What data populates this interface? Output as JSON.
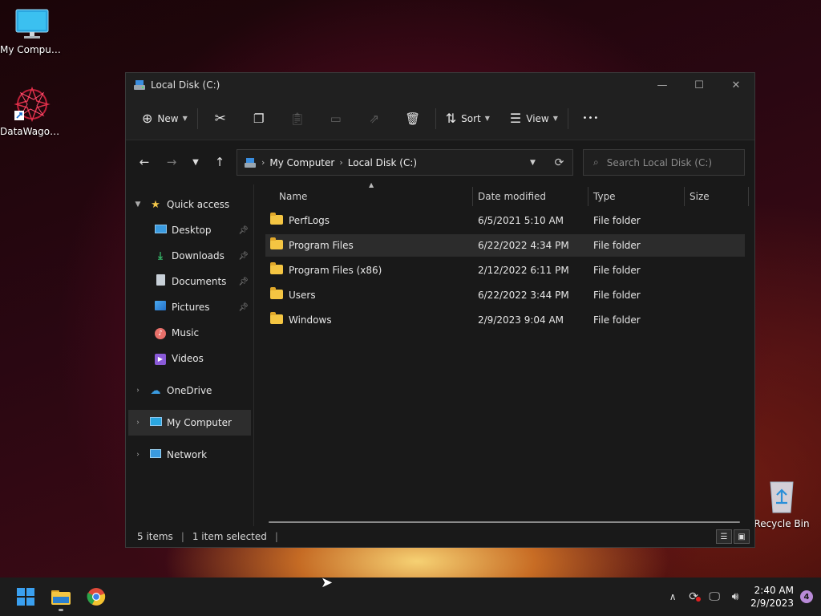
{
  "desktop": {
    "icons": [
      {
        "label": "My Computer",
        "icon": "monitor-icon"
      },
      {
        "label": "DataWagon...",
        "icon": "datawagon-shortcut-icon"
      },
      {
        "label": "Recycle Bin",
        "icon": "recycle-bin-icon"
      }
    ]
  },
  "window": {
    "title": "Local Disk (C:)",
    "controls": {
      "minimize": "—",
      "maximize": "☐",
      "close": "✕"
    }
  },
  "commandbar": {
    "new_label": "New",
    "sort_label": "Sort",
    "view_label": "View",
    "more_label": "•••"
  },
  "address": {
    "crumbs": [
      "My Computer",
      "Local Disk (C:)"
    ],
    "search_placeholder": "Search Local Disk (C:)"
  },
  "nav": {
    "quick_access": "Quick access",
    "items": [
      {
        "label": "Desktop",
        "pinned": true
      },
      {
        "label": "Downloads",
        "pinned": true
      },
      {
        "label": "Documents",
        "pinned": true
      },
      {
        "label": "Pictures",
        "pinned": true
      },
      {
        "label": "Music",
        "pinned": false
      },
      {
        "label": "Videos",
        "pinned": false
      }
    ],
    "onedrive": "OneDrive",
    "my_computer": "My Computer",
    "network": "Network"
  },
  "list": {
    "columns": [
      "Name",
      "Date modified",
      "Type",
      "Size"
    ],
    "rows": [
      {
        "name": "PerfLogs",
        "date": "6/5/2021 5:10 AM",
        "type": "File folder",
        "size": ""
      },
      {
        "name": "Program Files",
        "date": "6/22/2022 4:34 PM",
        "type": "File folder",
        "size": "",
        "selected": true
      },
      {
        "name": "Program Files (x86)",
        "date": "2/12/2022 6:11 PM",
        "type": "File folder",
        "size": ""
      },
      {
        "name": "Users",
        "date": "6/22/2022 3:44 PM",
        "type": "File folder",
        "size": ""
      },
      {
        "name": "Windows",
        "date": "2/9/2023 9:04 AM",
        "type": "File folder",
        "size": ""
      }
    ]
  },
  "status": {
    "items_count": "5 items",
    "selected_count": "1 item selected"
  },
  "taskbar": {
    "time": "2:40 AM",
    "date": "2/9/2023",
    "notifications": "4"
  },
  "colors": {
    "accent": "#0078d4",
    "folder": "#f4c542",
    "window_bg": "#191919",
    "taskbar_bg": "#1c1c1c"
  }
}
